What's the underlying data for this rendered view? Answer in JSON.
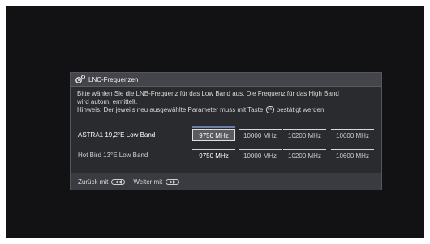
{
  "dialog": {
    "title": "LNC-Frequenzen",
    "info_line1": "Bitte wählen Sie die LNB-Frequenz für das Low Band aus. Die Frequenz für das High Band",
    "info_line2": "wird autom. ermittelt.",
    "info_line3_before": "Hinweis: Der jeweils neu ausgewählte Parameter muss mit Taste",
    "info_ok_key": "ok",
    "info_line3_after": "bestätigt werden."
  },
  "rows": [
    {
      "label": "ASTRA1 19,2°E Low Band",
      "options": [
        "9750 MHz",
        "10000 MHz",
        "10200 MHz",
        "10600 MHz"
      ],
      "selected": "9750 MHz"
    },
    {
      "label": "Hot Bird 13°E Low Band",
      "options": [
        "9750 MHz",
        "10000 MHz",
        "10200 MHz",
        "10600 MHz"
      ],
      "selected": "9750 MHz"
    }
  ],
  "footer": {
    "back_label": "Zurück mit",
    "back_icon": "rewind-key-icon",
    "next_label": "Weiter mit",
    "next_icon": "forward-key-icon"
  },
  "colors": {
    "screen_bg": "#121214",
    "dialog_bg": "#2a2b2f",
    "focus_accent": "#6e7ea8"
  }
}
